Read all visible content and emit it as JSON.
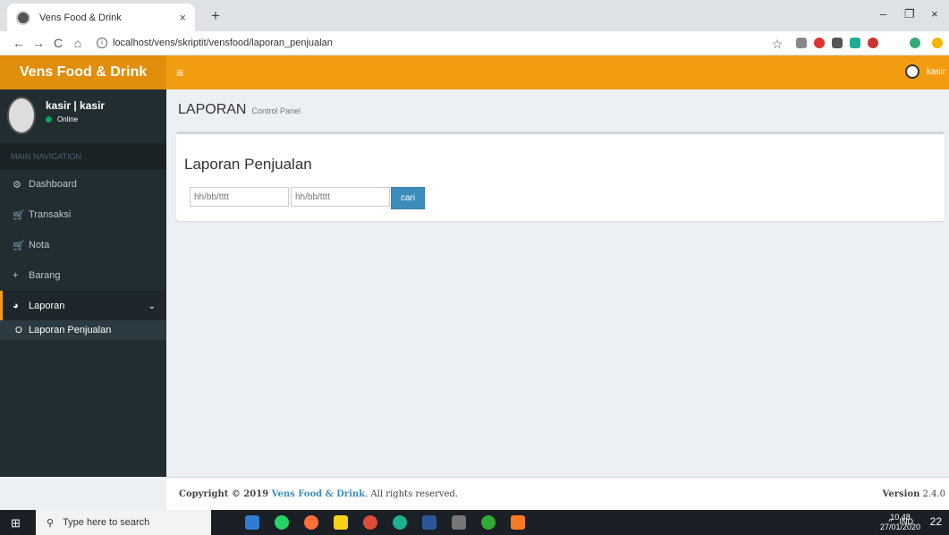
{
  "browser": {
    "tab_title": "Vens Food & Drink",
    "tab_close": "×",
    "new_tab": "+",
    "url": "localhost/vens/skriptit/vensfood/laporan_penjualan",
    "info_glyph": "i",
    "back": "←",
    "forward": "→",
    "reload": "C",
    "home": "⌂",
    "star": "☆",
    "minimize": "–",
    "restore": "❐",
    "close": "×"
  },
  "app": {
    "brand": "Vens Food & Drink",
    "hamburger": "≡",
    "top_user": "kasir"
  },
  "sidebar": {
    "user_name": "kasir | kasir",
    "user_status": "Online",
    "header": "MAIN NAVIGATION",
    "items": [
      {
        "label": "Dashboard",
        "icon": "dashboard-icon",
        "glyph": "⚙"
      },
      {
        "label": "Transaksi",
        "icon": "cart-icon",
        "glyph": "🛒"
      },
      {
        "label": "Nota",
        "icon": "cart-icon",
        "glyph": "🛒"
      },
      {
        "label": "Barang",
        "icon": "plus-icon",
        "glyph": "+"
      },
      {
        "label": "Laporan",
        "icon": "pie-chart-icon",
        "glyph": "◕",
        "chevron": "⌄"
      }
    ],
    "sub_items": [
      {
        "label": "Laporan Penjualan",
        "glyph": "O"
      }
    ]
  },
  "content": {
    "header": "LAPORAN",
    "subheader": "Control Panel",
    "box_title": "Laporan Penjualan",
    "date_from_placeholder": "hh/bb/tttt",
    "date_to_placeholder": "hh/bb/tttt",
    "search_button": "cari"
  },
  "footer": {
    "copyright_prefix": "Copyright © 2019 ",
    "copyright_brand": "Vens Food & Drink",
    "copyright_suffix": ". All rights reserved.",
    "version_label": "Version",
    "version": "2.4.0"
  },
  "taskbar": {
    "start": "⊞",
    "search_icon": "⚲",
    "search_placeholder": "Type here to search",
    "tray_caret": "^",
    "tray_lang": "IND",
    "time": "10.48",
    "date": "27/01/2020",
    "notifications": "22"
  },
  "colors": {
    "accent": "#f39c12",
    "accent_dark": "#e08e0b",
    "sidebar_bg": "#222d32",
    "primary_button": "#3c8dbc"
  }
}
